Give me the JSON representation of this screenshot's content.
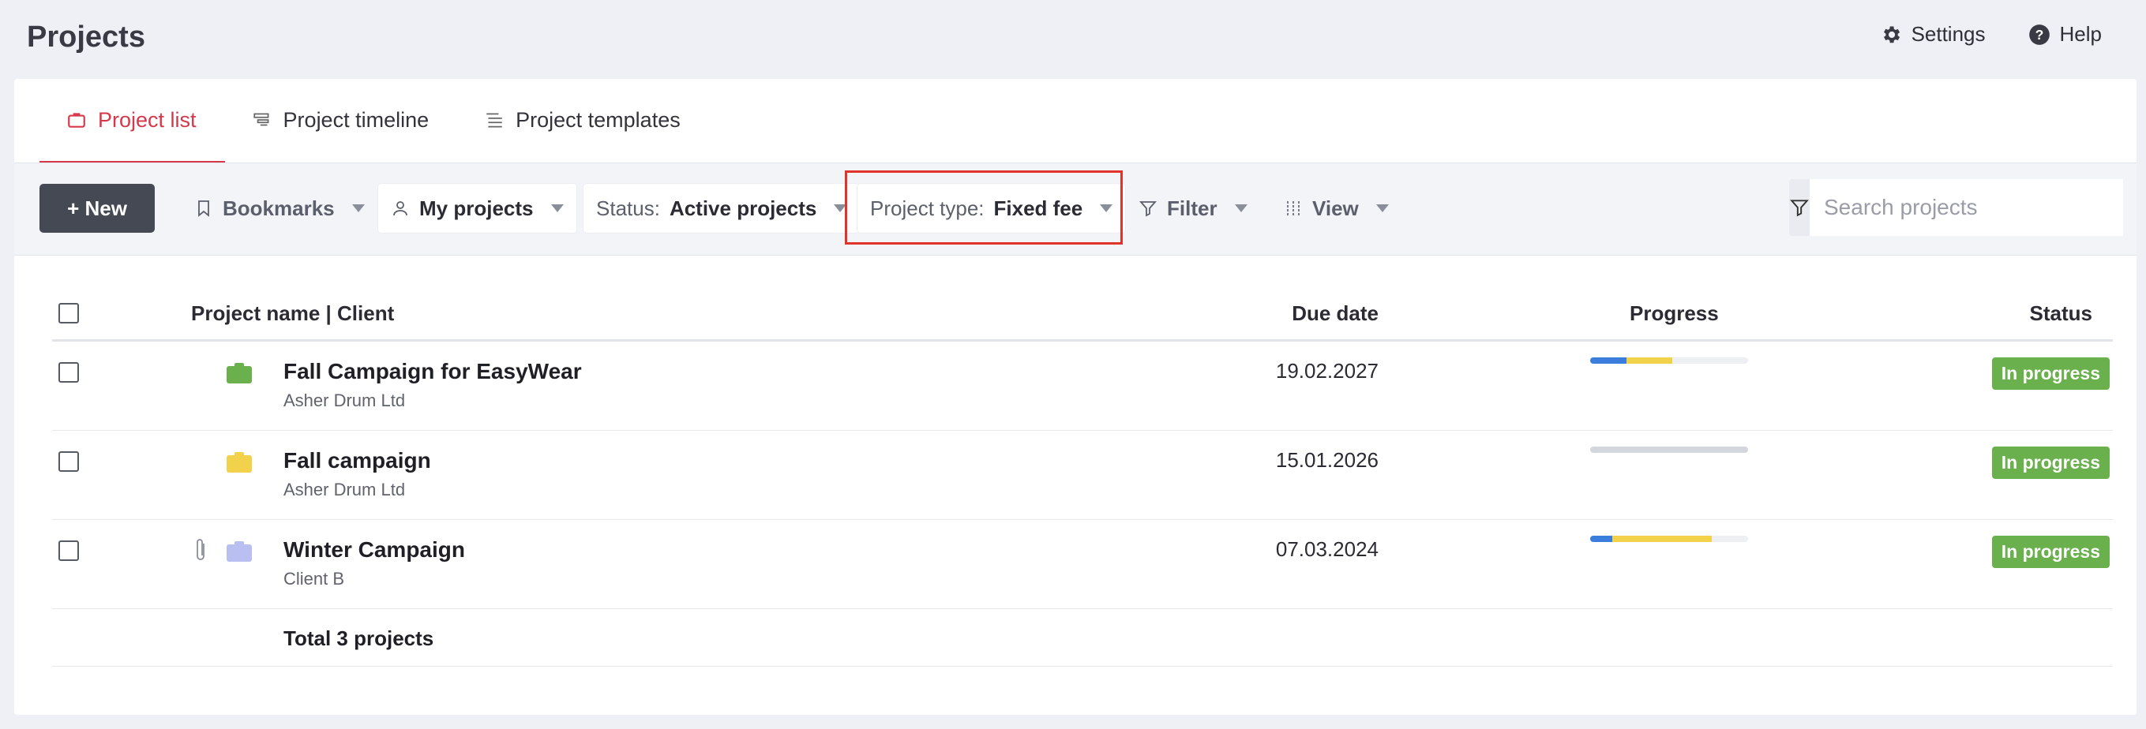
{
  "page": {
    "title": "Projects"
  },
  "top_actions": {
    "settings": "Settings",
    "help": "Help"
  },
  "tabs": [
    {
      "label": "Project list",
      "active": true,
      "icon": "briefcase-icon"
    },
    {
      "label": "Project timeline",
      "active": false,
      "icon": "timeline-icon"
    },
    {
      "label": "Project templates",
      "active": false,
      "icon": "list-icon"
    }
  ],
  "toolbar": {
    "new_label": "+ New",
    "bookmarks": "Bookmarks",
    "my_projects": "My projects",
    "status_prefix": "Status:",
    "status_value": "Active projects",
    "type_prefix": "Project type:",
    "type_value": "Fixed fee",
    "filter": "Filter",
    "view": "View",
    "search_placeholder": "Search projects"
  },
  "table": {
    "headers": {
      "name": "Project name | Client",
      "due": "Due date",
      "progress": "Progress",
      "status": "Status"
    },
    "rows": [
      {
        "name": "Fall Campaign for EasyWear",
        "client": "Asher Drum Ltd",
        "due": "19.02.2027",
        "status": "In progress",
        "folder_color": "#6ab04c",
        "attachment": false,
        "progress_segments": [
          {
            "color": "#3b7ddd",
            "fraction": 0.23
          },
          {
            "color": "#f2d14b",
            "fraction": 0.29
          }
        ]
      },
      {
        "name": "Fall campaign",
        "client": "Asher Drum Ltd",
        "due": "15.01.2026",
        "status": "In progress",
        "folder_color": "#f2d14b",
        "attachment": false,
        "progress_segments": [
          {
            "color": "#d3d6dd",
            "fraction": 1.0
          }
        ]
      },
      {
        "name": "Winter Campaign",
        "client": "Client B",
        "due": "07.03.2024",
        "status": "In progress",
        "folder_color": "#b9bff0",
        "attachment": true,
        "progress_segments": [
          {
            "color": "#3b7ddd",
            "fraction": 0.14
          },
          {
            "color": "#f2d14b",
            "fraction": 0.63
          }
        ]
      }
    ],
    "total": "Total 3 projects"
  }
}
